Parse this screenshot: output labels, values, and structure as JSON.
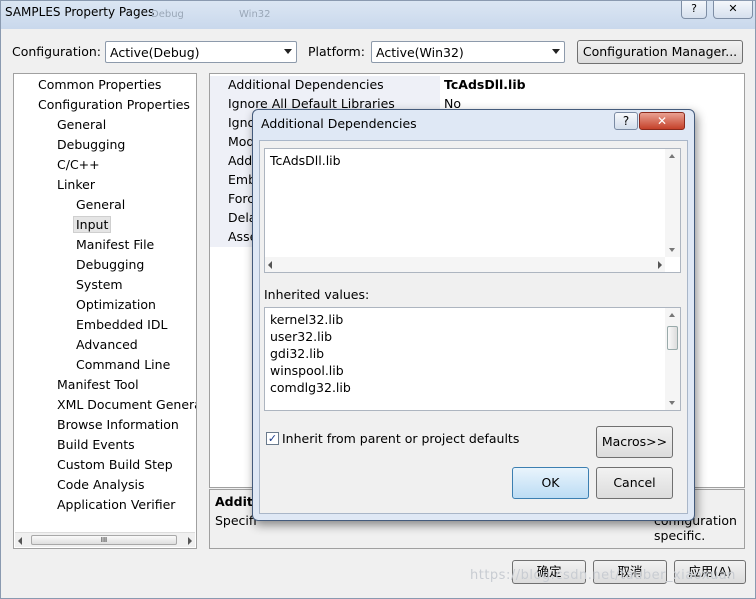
{
  "window": {
    "title": "SAMPLES Property Pages",
    "ghost_tab1": "Debug",
    "ghost_tab2": "Win32",
    "help_btn": "?",
    "close_btn": "✕"
  },
  "toolbar": {
    "config_label": "Configuration:",
    "config_value": "Active(Debug)",
    "platform_label": "Platform:",
    "platform_value": "Active(Win32)",
    "manager_button": "Configuration Manager..."
  },
  "tree": {
    "items": [
      "Common Properties",
      "Configuration Properties",
      "General",
      "Debugging",
      "C/C++",
      "Linker",
      "General",
      "Input",
      "Manifest File",
      "Debugging",
      "System",
      "Optimization",
      "Embedded IDL",
      "Advanced",
      "Command Line",
      "Manifest Tool",
      "XML Document Generat",
      "Browse Information",
      "Build Events",
      "Custom Build Step",
      "Code Analysis",
      "Application Verifier"
    ],
    "scroll_thumb": "III"
  },
  "grid": {
    "rows": [
      {
        "key": "Additional Dependencies",
        "value": "TcAdsDll.lib"
      },
      {
        "key": "Ignore All Default Libraries",
        "value": "No"
      },
      {
        "key": "Igno",
        "value": ""
      },
      {
        "key": "Mod",
        "value": ""
      },
      {
        "key": "Addi",
        "value": ""
      },
      {
        "key": "Emb",
        "value": ""
      },
      {
        "key": "Forc",
        "value": ""
      },
      {
        "key": "Dela",
        "value": ""
      },
      {
        "key": "Asse",
        "value": ""
      }
    ]
  },
  "description": {
    "title": "Additi",
    "text": "Specifi",
    "text_tail": "configuration specific."
  },
  "dialog": {
    "title": "Additional Dependencies",
    "help": "?",
    "close": "✕",
    "edit_value": "TcAdsDll.lib",
    "inherited_label": "Inherited values:",
    "inherited": [
      "kernel32.lib",
      "user32.lib",
      "gdi32.lib",
      "winspool.lib",
      "comdlg32.lib"
    ],
    "inherit_checkbox": "Inherit from parent or project defaults",
    "inherit_checked": true,
    "macros_button": "Macros>>",
    "ok_button": "OK",
    "cancel_button": "Cancel"
  },
  "footer": {
    "ok": "确定",
    "cancel": "取消",
    "apply": "应用(A)"
  },
  "watermark": "https://blog.csdn.net/tauber_xiaoxuan"
}
